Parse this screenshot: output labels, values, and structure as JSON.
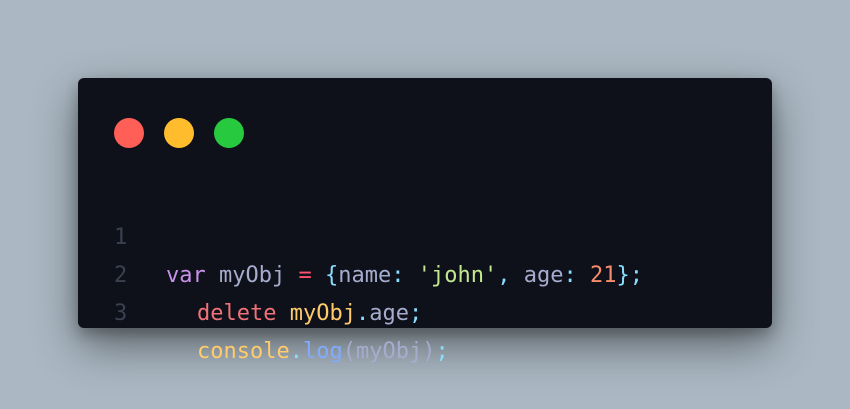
{
  "window": {
    "controls": [
      {
        "name": "close",
        "color": "#ff5f56"
      },
      {
        "name": "minimize",
        "color": "#ffbd2e"
      },
      {
        "name": "maximize",
        "color": "#27c93f"
      }
    ]
  },
  "code": {
    "lines": [
      {
        "number": "1",
        "tokens": {
          "kw": "var",
          "sp1": " ",
          "ident": "myObj",
          "sp2": " ",
          "eq": "=",
          "sp3": " ",
          "lbrace": "{",
          "key1": "name",
          "colon1": ":",
          "sp4": " ",
          "str": "'john'",
          "comma": ",",
          "sp5": " ",
          "key2": "age",
          "colon2": ":",
          "sp6": " ",
          "num": "21",
          "rbrace": "}",
          "semi": ";"
        }
      },
      {
        "number": "2",
        "tokens": {
          "del": "delete",
          "sp1": " ",
          "obj": "myObj",
          "dot": ".",
          "prop": "age",
          "semi": ";"
        }
      },
      {
        "number": "3",
        "tokens": {
          "obj": "console",
          "dot": ".",
          "fn": "log",
          "lparen": "(",
          "arg": "myObj",
          "rparen": ")",
          "semi": ";"
        }
      }
    ]
  }
}
